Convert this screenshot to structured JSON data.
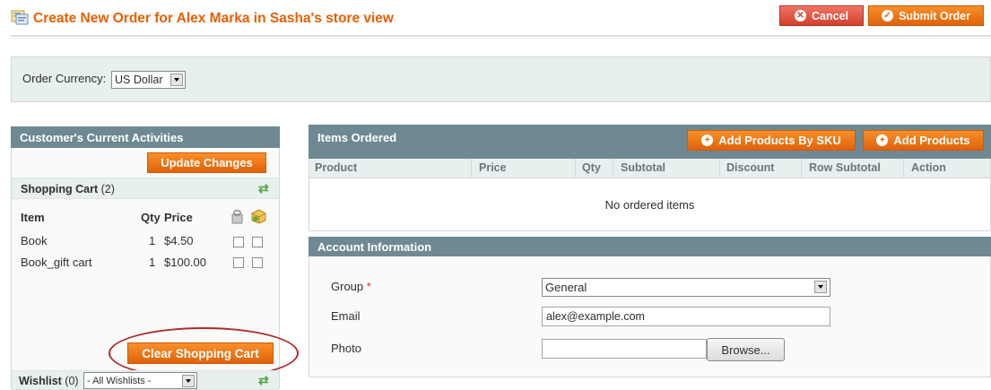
{
  "header": {
    "title": "Create New Order for Alex Marka in Sasha's store view",
    "cancel_label": "Cancel",
    "submit_label": "Submit Order"
  },
  "currency": {
    "label": "Order Currency:",
    "selected": "US Dollar"
  },
  "activities": {
    "title": "Customer's Current Activities",
    "update_label": "Update Changes",
    "shopping_cart": {
      "title": "Shopping Cart",
      "count": "(2)",
      "col_item": "Item",
      "col_qty": "Qty",
      "col_price": "Price",
      "items": [
        {
          "name": "Book",
          "qty": "1",
          "price": "$4.50"
        },
        {
          "name": "Book_gift cart",
          "qty": "1",
          "price": "$100.00"
        }
      ],
      "clear_label": "Clear Shopping Cart"
    },
    "wishlist": {
      "title": "Wishlist",
      "count": "(0)",
      "selected": "- All Wishlists -"
    }
  },
  "items_ordered": {
    "title": "Items Ordered",
    "add_by_sku_label": "Add Products By SKU",
    "add_products_label": "Add Products",
    "columns": [
      "Product",
      "Price",
      "Qty",
      "Subtotal",
      "Discount",
      "Row Subtotal",
      "Action"
    ],
    "empty_text": "No ordered items"
  },
  "account": {
    "title": "Account Information",
    "group_label": "Group",
    "required_mark": "*",
    "group_value": "General",
    "email_label": "Email",
    "email_value": "alex@example.com",
    "photo_label": "Photo",
    "browse_label": "Browse..."
  },
  "colors": {
    "accent_orange": "#eb5e00",
    "panel_header": "#6f8992",
    "cancel_red": "#d2402c",
    "annotation": "#b02a2a"
  },
  "icons": [
    "order-icon",
    "cancel-x-icon",
    "submit-check-icon",
    "refresh-icon",
    "plus-icon",
    "cart-remove-icon",
    "cart-move-icon"
  ]
}
